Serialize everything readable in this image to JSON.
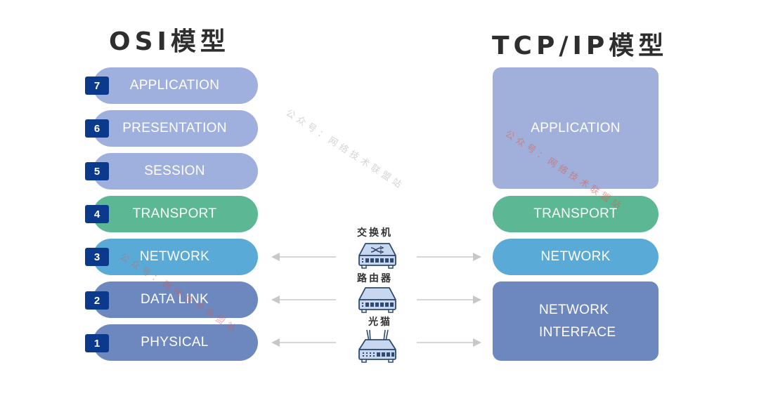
{
  "titles": {
    "osi": "OSI模型",
    "tcpip": "TCP/IP模型"
  },
  "osi_layers": [
    {
      "number": "7",
      "label": "APPLICATION",
      "color": "#9fb0de"
    },
    {
      "number": "6",
      "label": "PRESENTATION",
      "color": "#9fb0de"
    },
    {
      "number": "5",
      "label": "SESSION",
      "color": "#9fb0de"
    },
    {
      "number": "4",
      "label": "TRANSPORT",
      "color": "#5cb795"
    },
    {
      "number": "3",
      "label": "NETWORK",
      "color": "#5aaad8"
    },
    {
      "number": "2",
      "label": "DATA LINK",
      "color": "#6c88bf"
    },
    {
      "number": "1",
      "label": "PHYSICAL",
      "color": "#6c88bf"
    }
  ],
  "tcpip_layers": [
    {
      "label": "APPLICATION",
      "color": "#a0b0db"
    },
    {
      "label": "TRANSPORT",
      "color": "#5cb795"
    },
    {
      "label": "NETWORK",
      "color": "#5aaad8"
    },
    {
      "label_line1": "NETWORK",
      "label_line2": "INTERFACE",
      "color": "#6c88bf"
    }
  ],
  "devices": [
    {
      "label": "交换机",
      "icon": "switch-icon",
      "osi_layer": "3"
    },
    {
      "label": "路由器",
      "icon": "router-icon",
      "osi_layer": "2"
    },
    {
      "label": "光猫",
      "icon": "optical-modem-icon",
      "osi_layer": "1"
    }
  ],
  "badge_color": "#0b3a8c",
  "watermark": "公众号：网络技术联盟站"
}
